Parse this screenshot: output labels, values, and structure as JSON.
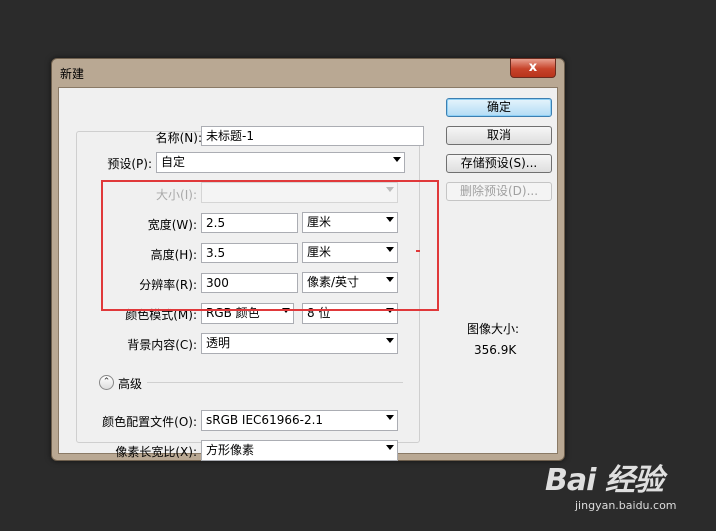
{
  "window": {
    "title": "新建",
    "close_glyph": "x"
  },
  "form": {
    "name_label": "名称(N):",
    "name_value": "未标题-1",
    "preset_label": "预设(P):",
    "preset_value": "自定",
    "size_label": "大小(I):",
    "size_value": "",
    "width_label": "宽度(W):",
    "width_value": "2.5",
    "width_unit": "厘米",
    "height_label": "高度(H):",
    "height_value": "3.5",
    "height_unit": "厘米",
    "resolution_label": "分辨率(R):",
    "resolution_value": "300",
    "resolution_unit": "像素/英寸",
    "color_mode_label": "颜色模式(M):",
    "color_mode_value": "RGB 颜色",
    "bit_depth_value": "8 位",
    "background_label": "背景内容(C):",
    "background_value": "透明",
    "advanced_label": "高级",
    "color_profile_label": "颜色配置文件(O):",
    "color_profile_value": "sRGB IEC61966-2.1",
    "pixel_aspect_label": "像素长宽比(X):",
    "pixel_aspect_value": "方形像素"
  },
  "buttons": {
    "ok": "确定",
    "cancel": "取消",
    "save_preset": "存储预设(S)...",
    "delete_preset": "删除预设(D)..."
  },
  "image_size": {
    "label": "图像大小:",
    "value": "356.9K"
  },
  "watermark": {
    "logo": "Bai 经验",
    "site": "jingyan.baidu.com"
  },
  "colors": {
    "highlight_box": "#e0383a",
    "dialog_frame": "#b9a893",
    "background": "#2b2b2b"
  }
}
